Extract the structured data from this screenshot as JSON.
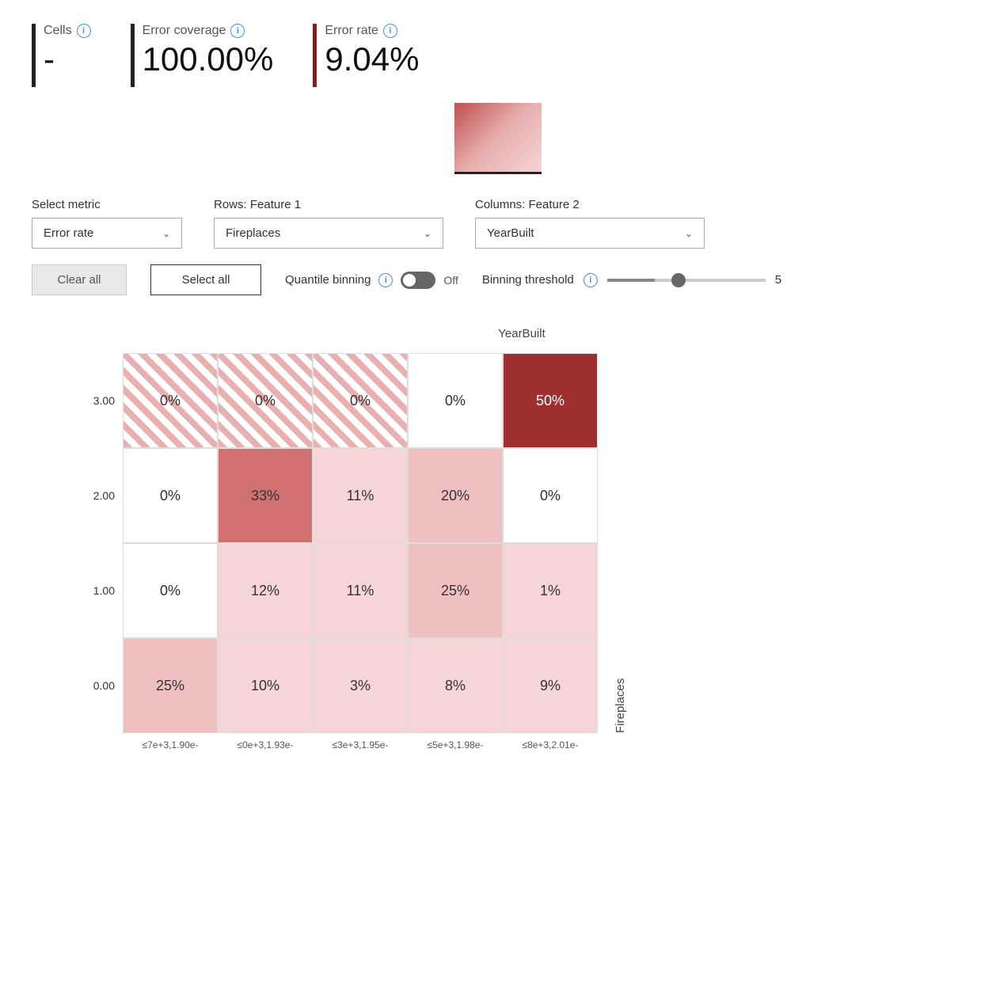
{
  "metrics": {
    "cells": {
      "label": "Cells",
      "value": "-",
      "bar_color": "dark"
    },
    "error_coverage": {
      "label": "Error coverage",
      "value": "100.00%",
      "bar_color": "dark"
    },
    "error_rate": {
      "label": "Error rate",
      "value": "9.04%",
      "bar_color": "red"
    }
  },
  "controls": {
    "metric_label": "Select metric",
    "metric_value": "Error rate",
    "rows_label": "Rows: Feature 1",
    "rows_value": "Fireplaces",
    "cols_label": "Columns: Feature 2",
    "cols_value": "YearBuilt",
    "clear_all": "Clear all",
    "select_all": "Select all",
    "quantile_label": "Quantile binning",
    "toggle_state": "Off",
    "binning_label": "Binning threshold",
    "binning_value": "5"
  },
  "heatmap": {
    "col_axis_label": "YearBuilt",
    "row_axis_label": "Fireplaces",
    "y_labels": [
      "3.00",
      "2.00",
      "1.00",
      "0.00"
    ],
    "x_labels": [
      "≤7e+3,1.90e-",
      "≤0e+3,1.93e-",
      "≤3e+3,1.95e-",
      "≤5e+3,1.98e-",
      "≤8e+3,2.01e-"
    ],
    "rows": [
      [
        {
          "value": "0%",
          "style": "cell-hatched"
        },
        {
          "value": "0%",
          "style": "cell-hatched"
        },
        {
          "value": "0%",
          "style": "cell-hatched"
        },
        {
          "value": "0%",
          "style": "cell-plain"
        },
        {
          "value": "50%",
          "style": "cell-dark-red"
        }
      ],
      [
        {
          "value": "0%",
          "style": "cell-plain"
        },
        {
          "value": "33%",
          "style": "cell-medium-rose"
        },
        {
          "value": "11%",
          "style": "cell-light-pink"
        },
        {
          "value": "20%",
          "style": "cell-light-rose"
        },
        {
          "value": "0%",
          "style": "cell-plain"
        }
      ],
      [
        {
          "value": "0%",
          "style": "cell-plain"
        },
        {
          "value": "12%",
          "style": "cell-light-pink"
        },
        {
          "value": "11%",
          "style": "cell-light-pink"
        },
        {
          "value": "25%",
          "style": "cell-light-rose"
        },
        {
          "value": "1%",
          "style": "cell-light-pink"
        }
      ],
      [
        {
          "value": "25%",
          "style": "cell-light-rose"
        },
        {
          "value": "10%",
          "style": "cell-light-pink"
        },
        {
          "value": "3%",
          "style": "cell-light-pink"
        },
        {
          "value": "8%",
          "style": "cell-light-pink"
        },
        {
          "value": "9%",
          "style": "cell-light-pink"
        }
      ]
    ]
  }
}
